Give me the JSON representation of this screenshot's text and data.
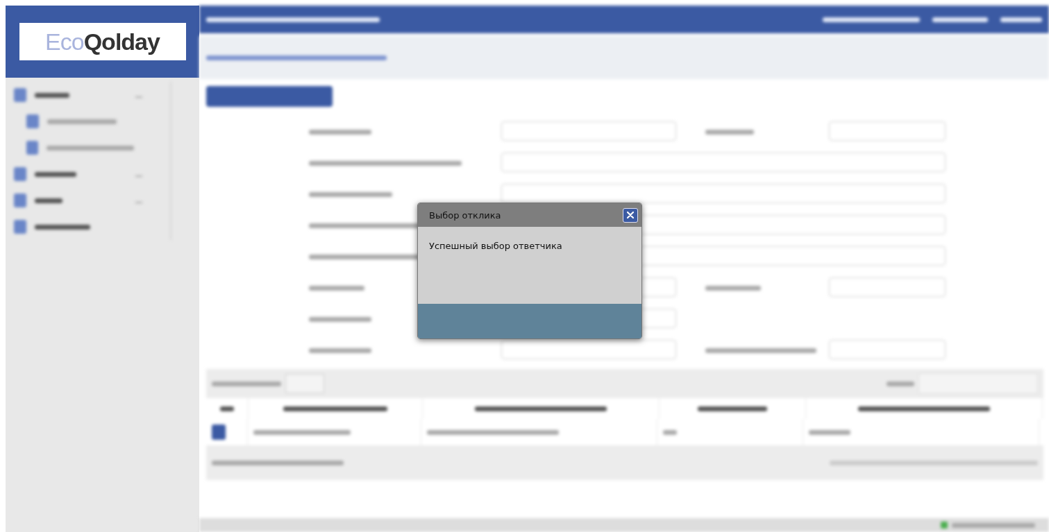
{
  "logo": {
    "parts": [
      "Eco",
      "Qolday"
    ]
  },
  "dialog": {
    "title": "Выбор отклика",
    "message": "Успешный выбор ответчика"
  }
}
